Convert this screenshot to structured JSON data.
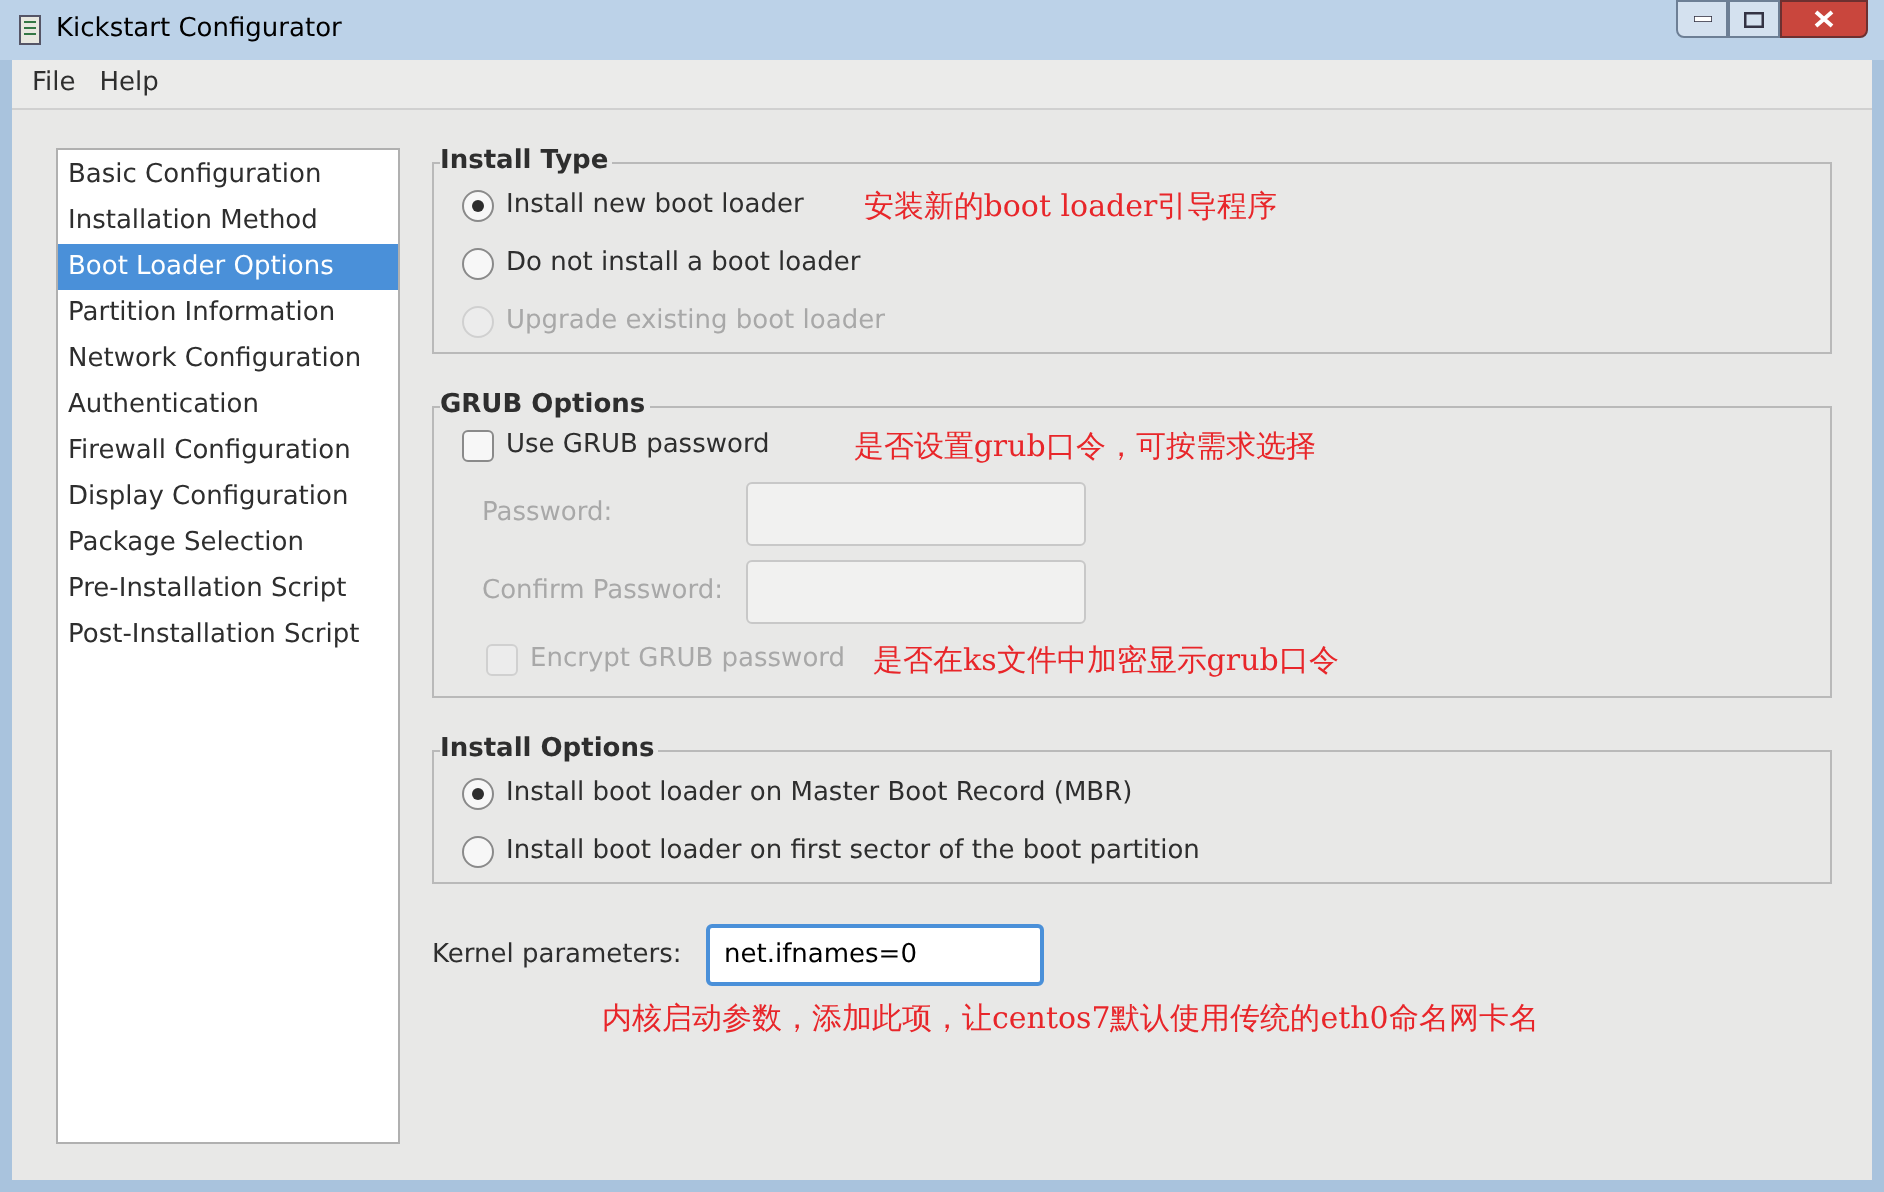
{
  "window": {
    "title": "Kickstart Configurator"
  },
  "menu": [
    "File",
    "Help"
  ],
  "sidebar": {
    "items": [
      {
        "label": "Basic Configuration",
        "selected": false
      },
      {
        "label": "Installation Method",
        "selected": false
      },
      {
        "label": "Boot Loader Options",
        "selected": true
      },
      {
        "label": "Partition Information",
        "selected": false
      },
      {
        "label": "Network Configuration",
        "selected": false
      },
      {
        "label": "Authentication",
        "selected": false
      },
      {
        "label": "Firewall Configuration",
        "selected": false
      },
      {
        "label": "Display Configuration",
        "selected": false
      },
      {
        "label": "Package Selection",
        "selected": false
      },
      {
        "label": "Pre-Installation Script",
        "selected": false
      },
      {
        "label": "Post-Installation Script",
        "selected": false
      }
    ]
  },
  "install_type": {
    "title": "Install Type",
    "options": [
      {
        "label": "Install new boot loader",
        "selected": true,
        "disabled": false,
        "note": "安装新的boot loader引导程序"
      },
      {
        "label": "Do not install a boot loader",
        "selected": false,
        "disabled": false
      },
      {
        "label": "Upgrade existing boot loader",
        "selected": false,
        "disabled": true
      }
    ]
  },
  "grub_options": {
    "title": "GRUB Options",
    "use_password": {
      "label": "Use GRUB password",
      "checked": false,
      "disabled": false,
      "note": "是否设置grub口令，可按需求选择"
    },
    "fields": [
      {
        "label": "Password:",
        "disabled": true
      },
      {
        "label": "Confirm Password:",
        "disabled": true
      }
    ],
    "encrypt": {
      "label": "Encrypt GRUB password",
      "checked": false,
      "disabled": true,
      "note": "是否在ks文件中加密显示grub口令"
    }
  },
  "install_options": {
    "title": "Install Options",
    "options": [
      {
        "label": "Install boot loader on Master Boot Record (MBR)",
        "selected": true,
        "disabled": false
      },
      {
        "label": "Install boot loader on first sector of the boot partition",
        "selected": false,
        "disabled": false
      }
    ]
  },
  "kernel": {
    "label": "Kernel parameters:",
    "value": "net.ifnames=0",
    "note": "内核启动参数，添加此项，让centos7默认使用传统的eth0命名网卡名"
  }
}
